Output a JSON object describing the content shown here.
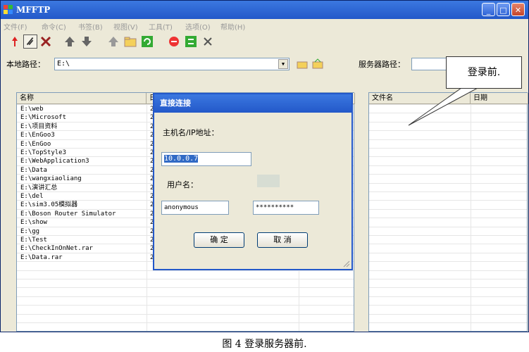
{
  "window": {
    "title": "MFFTP"
  },
  "menu": [
    "文件(F)",
    "命令(C)",
    "书签(B)",
    "视图(V)",
    "工具(T)",
    "选项(O)",
    "帮助(H)"
  ],
  "local": {
    "label": "本地路径：",
    "path": "E:\\"
  },
  "server": {
    "label": "服务器路径：",
    "path": ""
  },
  "local_columns": {
    "name": "名称",
    "date": "日"
  },
  "remote_columns": {
    "name": "文件名",
    "date": "日期"
  },
  "files": [
    "E:\\web",
    "E:\\Microsoft",
    "E:\\项目资料",
    "E:\\EnGoo3",
    "E:\\EnGoo",
    "E:\\TopStyle3",
    "E:\\WebApplication3",
    "E:\\Data",
    "E:\\wangxiaoliang",
    "E:\\演讲汇总",
    "E:\\del",
    "E:\\sim3.05模拟器",
    "E:\\Boson Router Simulator",
    "E:\\show",
    "E:\\gg",
    "E:\\Test",
    "E:\\CheckInOnNet.rar",
    "E:\\Data.rar"
  ],
  "file_dates": [
    "2",
    "2",
    "2",
    "2",
    "2",
    "2",
    "2",
    "2",
    "2",
    "2",
    "2",
    "2",
    "2",
    "2",
    "2",
    "2",
    "2",
    "2"
  ],
  "dialog": {
    "title": "直接连接",
    "host_label": "主机名/IP地址：",
    "host": "10.0.0.7",
    "user_label": "用户名：",
    "user": "anonymous",
    "password": "**********",
    "ok": "确 定",
    "cancel": "取 消"
  },
  "callout": "登录前.",
  "caption": "图 4 登录服务器前.",
  "colors": {
    "titlebar": "#2358c9",
    "window_bg": "#ece9d8",
    "border": "#7f9db9"
  }
}
